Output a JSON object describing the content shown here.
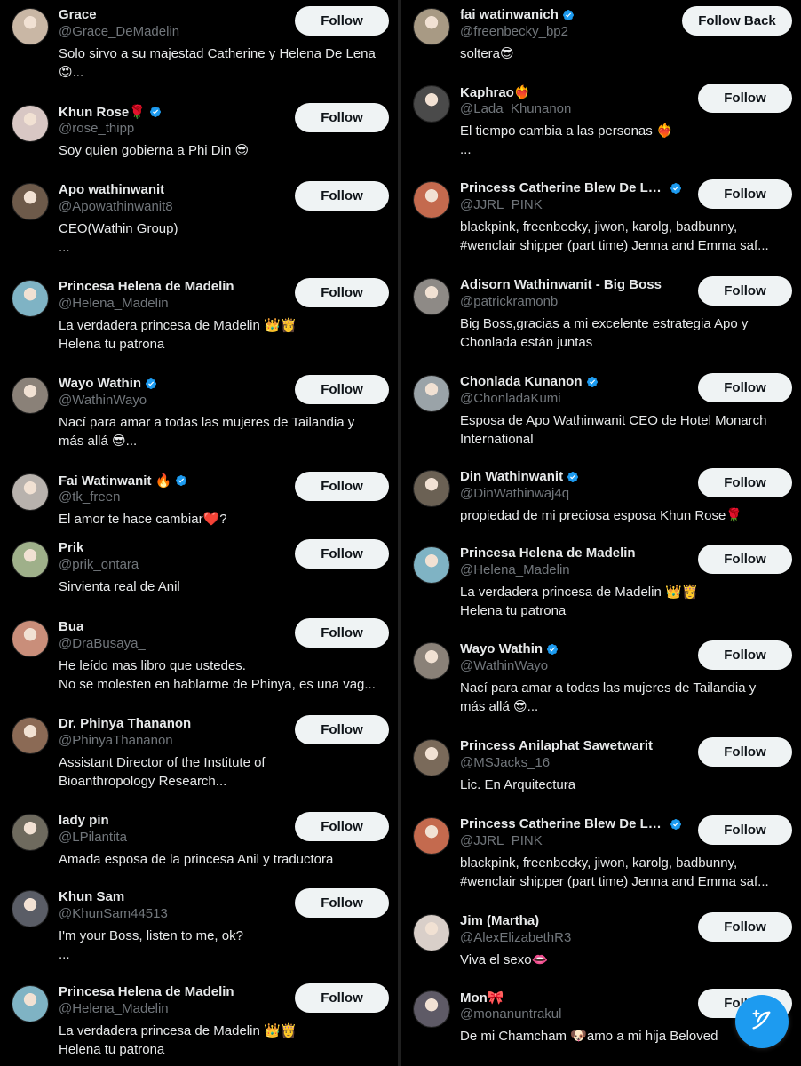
{
  "colors": {
    "background": "#000000",
    "accent": "#1d9bf0",
    "button_bg": "#eff3f4",
    "handle": "#71767b"
  },
  "icons": {
    "verified": "verified-badge-icon",
    "compose": "compose-post-icon"
  },
  "left": [
    {
      "name": "Grace",
      "verified": false,
      "handle": "@Grace_DeMadelin",
      "bio": "Solo sirvo a su majestad Catherine y Helena De Lena\n😍...",
      "button": "Follow",
      "avatar": "#c9b7a5"
    },
    {
      "name": "Khun Rose🌹",
      "verified": true,
      "handle": "@rose_thipp",
      "bio": "Soy quien gobierna a Phi Din 😎",
      "button": "Follow",
      "avatar": "#d8c7c4"
    },
    {
      "name": "Apo wathinwanit",
      "verified": false,
      "handle": "@Apowathinwanit8",
      "bio": "CEO(Wathin Group)\n...",
      "button": "Follow",
      "avatar": "#6d5a4a"
    },
    {
      "name": "Princesa Helena de Madelin",
      "verified": false,
      "handle": "@Helena_Madelin",
      "bio": "La verdadera princesa de Madelin 👑👸\nHelena tu patrona",
      "button": "Follow",
      "avatar": "#7fb3c4"
    },
    {
      "name": "Wayo Wathin",
      "verified": true,
      "handle": "@WathinWayo",
      "bio": "Nací para amar a todas las mujeres de Tailandia y\nmás allá 😎...",
      "button": "Follow",
      "avatar": "#8a8178"
    },
    {
      "name": "Fai Watinwanit 🔥",
      "verified": true,
      "handle": "@tk_freen",
      "bio": "El amor te hace cambiar❤️?",
      "button": "Follow",
      "avatar": "#b8b2ad"
    },
    {
      "name": "Prik",
      "verified": false,
      "handle": "@prik_ontara",
      "bio": "Sirvienta real de Anil",
      "button": "Follow",
      "avatar": "#9fb08a"
    },
    {
      "name": "Bua",
      "verified": false,
      "handle": "@DraBusaya_",
      "bio": "He leído mas libro que ustedes.\nNo se molesten en hablarme de Phinya, es una vag...",
      "button": "Follow",
      "avatar": "#c98e7a"
    },
    {
      "name": "Dr. Phinya Thananon",
      "verified": false,
      "handle": "@PhinyaThananon",
      "bio": "Assistant Director of the Institute of\nBioanthropology Research...",
      "button": "Follow",
      "avatar": "#8b6a55"
    },
    {
      "name": "lady pin",
      "verified": false,
      "handle": "@LPilantita",
      "bio": "Amada esposa de la princesa Anil y traductora",
      "button": "Follow",
      "avatar": "#6e6a5e"
    },
    {
      "name": "Khun Sam",
      "verified": false,
      "handle": "@KhunSam44513",
      "bio": "I'm your Boss, listen to me, ok?\n...",
      "button": "Follow",
      "avatar": "#5a5d66"
    },
    {
      "name": "Princesa Helena de Madelin",
      "verified": false,
      "handle": "@Helena_Madelin",
      "bio": "La verdadera princesa de Madelin 👑👸\nHelena tu patrona",
      "button": "Follow",
      "avatar": "#7fb3c4"
    }
  ],
  "right": [
    {
      "name": "fai watinwanich",
      "verified": true,
      "handle": "@freenbecky_bp2",
      "bio": "soltera😎",
      "button": "Follow Back",
      "avatar": "#a89a84"
    },
    {
      "name": "Kaphrao❤️‍🔥",
      "verified": false,
      "handle": "@Lada_Khunanon",
      "bio": "El tiempo cambia a las personas ❤️‍🔥\n...",
      "button": "Follow",
      "avatar": "#4a4a4a"
    },
    {
      "name": "Princess Catherine Blew De Lai...",
      "verified": true,
      "handle": "@JJRL_PINK",
      "bio": "blackpink, freenbecky, jiwon, karolg, badbunny,\n#wenclair shipper (part time) Jenna and Emma saf...",
      "button": "Follow",
      "avatar": "#c46a4e"
    },
    {
      "name": "Adisorn Wathinwanit - Big Boss",
      "verified": false,
      "handle": "@patrickramonb",
      "bio": "Big Boss,gracias a mi excelente estrategia Apo y\nChonlada están juntas",
      "button": "Follow",
      "avatar": "#8e8a86"
    },
    {
      "name": "Chonlada Kunanon",
      "verified": true,
      "handle": "@ChonladaKumi",
      "bio": "Esposa de Apo Wathinwanit CEO de Hotel Monarch\nInternational",
      "button": "Follow",
      "avatar": "#9aa3a8"
    },
    {
      "name": "Din Wathinwanit",
      "verified": true,
      "handle": "@DinWathinwaj4q",
      "bio": "propiedad de mi preciosa esposa Khun Rose🌹",
      "button": "Follow",
      "avatar": "#6b6154"
    },
    {
      "name": "Princesa Helena de Madelin",
      "verified": false,
      "handle": "@Helena_Madelin",
      "bio": "La verdadera princesa de Madelin 👑👸\nHelena tu patrona",
      "button": "Follow",
      "avatar": "#7fb3c4"
    },
    {
      "name": "Wayo Wathin",
      "verified": true,
      "handle": "@WathinWayo",
      "bio": "Nací para amar a todas las mujeres de Tailandia y\nmás allá 😎...",
      "button": "Follow",
      "avatar": "#8a8178"
    },
    {
      "name": "Princess Anilaphat Sawetwarit",
      "verified": false,
      "handle": "@MSJacks_16",
      "bio": "Lic. En Arquitectura",
      "button": "Follow",
      "avatar": "#7a6a5a"
    },
    {
      "name": "Princess Catherine Blew De Lai...",
      "verified": true,
      "handle": "@JJRL_PINK",
      "bio": "blackpink, freenbecky, jiwon, karolg, badbunny,\n#wenclair shipper (part time) Jenna and Emma saf...",
      "button": "Follow",
      "avatar": "#c46a4e"
    },
    {
      "name": "Jim (Martha)",
      "verified": false,
      "handle": "@AlexElizabethR3",
      "bio": "Viva el sexo👄",
      "button": "Follow",
      "avatar": "#d9cfc9"
    },
    {
      "name": "Mon🎀",
      "verified": false,
      "handle": "@monanuntrakul",
      "bio": "De mi Chamcham 🐶amo a mi hija Beloved",
      "button": "Follow",
      "avatar": "#5e5a66"
    }
  ]
}
